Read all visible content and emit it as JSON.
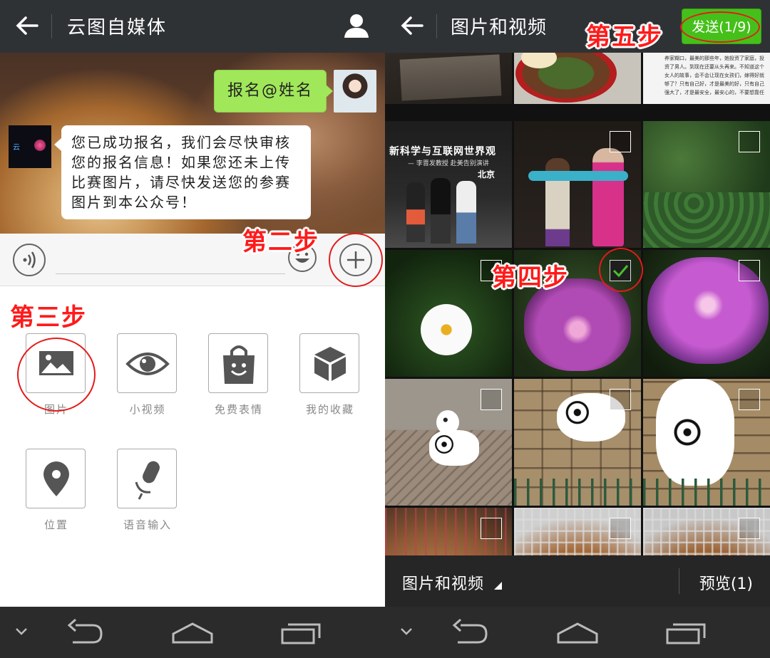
{
  "left": {
    "header": {
      "title": "云图自媒体"
    },
    "chat": {
      "user_message": "报名@姓名",
      "bot_logo_text": "云",
      "bot_message": "您已成功报名，我们会尽快审核您的报名信息！如果您还未上传比赛图片，请尽快发送您的参赛图片到本公众号！"
    },
    "tools": [
      {
        "label": "图片",
        "icon": "image-icon"
      },
      {
        "label": "小视频",
        "icon": "eye-icon"
      },
      {
        "label": "免费表情",
        "icon": "sticker-bag-icon"
      },
      {
        "label": "我的收藏",
        "icon": "cube-icon"
      },
      {
        "label": "位置",
        "icon": "location-pin-icon"
      },
      {
        "label": "语音输入",
        "icon": "microphone-icon"
      }
    ],
    "annotations": {
      "step2": "第二步",
      "step3": "第三步"
    }
  },
  "right": {
    "header": {
      "title": "图片和视频",
      "send_label": "发送(1/9)"
    },
    "annotations": {
      "step4": "第四步",
      "step5": "第五步"
    },
    "photo_text": {
      "exhibition_banner": "新科学与互联网世界观",
      "exhibition_sub": "— 李晋发教授 赴美告别演讲",
      "exhibition_city": "北京",
      "article_text": "养家糊口，最美的那些年，她投资了家庭，投资了男人。到现在还要从头再来。不知道这个女人的故事，会不会让现在女孩们，嫁得好就够了？只有自己好，才是最美的好，只有自己强大了，才是最安全，最安心的，不要想靠任何人，还是得靠自己！"
    },
    "photos": [
      {
        "subject": "document-photo",
        "checked": false
      },
      {
        "subject": "food-bowl",
        "checked": false
      },
      {
        "subject": "article-screenshot",
        "checked": false
      },
      {
        "subject": "exhibition-group",
        "checked": false
      },
      {
        "subject": "costume-people",
        "checked": false
      },
      {
        "subject": "green-plants",
        "checked": false
      },
      {
        "subject": "white-flower",
        "checked": false
      },
      {
        "subject": "purple-flower",
        "checked": true
      },
      {
        "subject": "purple-flower-2",
        "checked": false
      },
      {
        "subject": "dalmatian-street",
        "checked": false
      },
      {
        "subject": "dalmatian-wall",
        "checked": false
      },
      {
        "subject": "dalmatian-wall-2",
        "checked": false
      },
      {
        "subject": "cat-cage",
        "checked": false
      },
      {
        "subject": "cat-cage-2",
        "checked": false
      },
      {
        "subject": "cat-cage-3",
        "checked": false
      }
    ],
    "footer": {
      "folder_label": "图片和视频",
      "preview_label": "预览(1)"
    }
  },
  "colors": {
    "topbar": "#2f3235",
    "send_green": "#45c01a",
    "bubble_green": "#a0e75a",
    "annotation_red": "#ff1a1a"
  }
}
